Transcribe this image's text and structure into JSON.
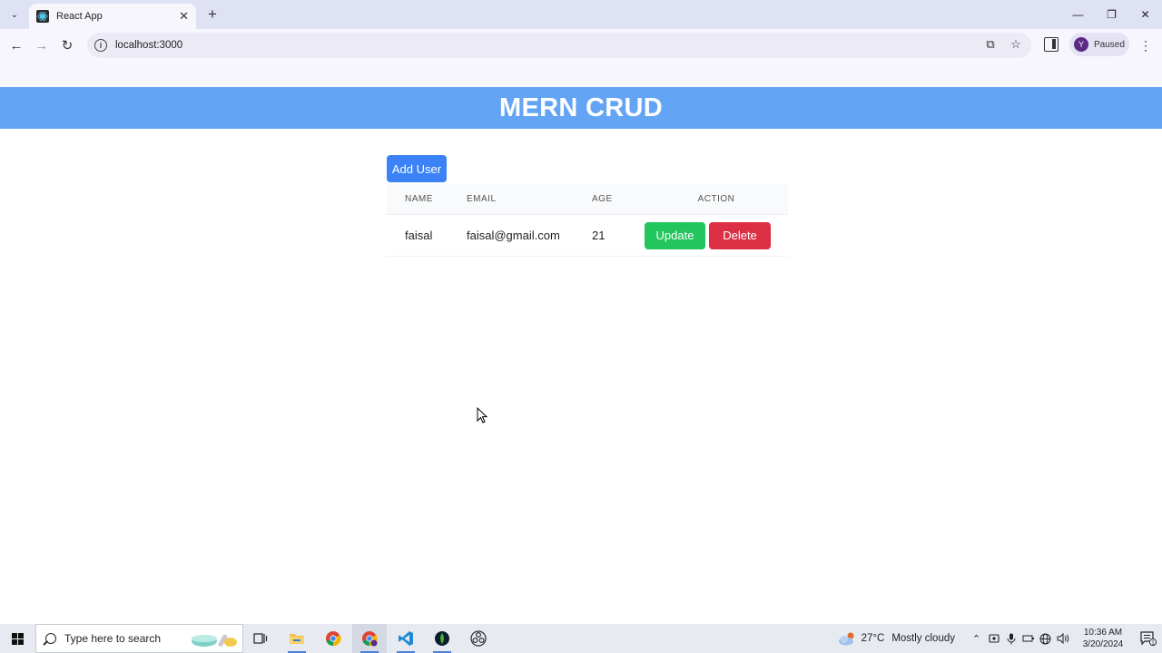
{
  "browser": {
    "tab_title": "React App",
    "url": "localhost:3000",
    "profile_initial": "Y",
    "profile_status": "Paused",
    "icons": [
      "tab-search-icon",
      "react-favicon-icon",
      "close-icon",
      "plus-icon",
      "back-icon",
      "forward-icon",
      "reload-icon",
      "info-icon",
      "install-app-icon",
      "star-icon",
      "side-panel-icon",
      "kebab-menu-icon"
    ]
  },
  "app": {
    "title": "MERN CRUD",
    "add_user_label": "Add User",
    "table": {
      "headers": [
        "NAME",
        "EMAIL",
        "AGE",
        "ACTION"
      ],
      "rows": [
        {
          "name": "faisal",
          "email": "faisal@gmail.com",
          "age": "21",
          "update_label": "Update",
          "delete_label": "Delete"
        }
      ]
    },
    "colors": {
      "header": "#63a4f5",
      "add": "#3b82f6",
      "update": "#22c55e",
      "delete": "#dc2f45"
    }
  },
  "taskbar": {
    "search_placeholder": "Type here to search",
    "weather_temp": "27°C",
    "weather_desc": "Mostly cloudy",
    "time": "10:36 AM",
    "date": "3/20/2024",
    "notification_count": "1",
    "apps": [
      "task-view-icon",
      "file-explorer-icon",
      "chrome-icon",
      "chrome-profile-icon",
      "vscode-icon",
      "mongodb-compass-icon",
      "obs-icon"
    ]
  }
}
